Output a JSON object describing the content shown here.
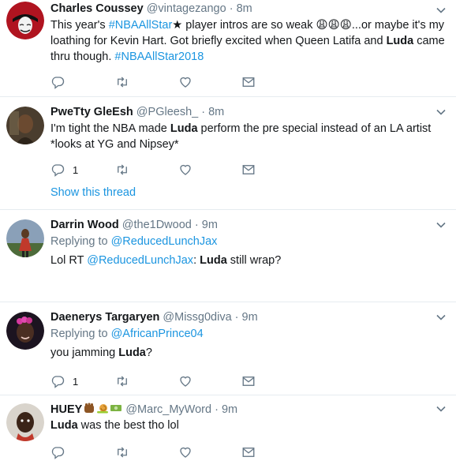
{
  "tweets": [
    {
      "name": "Charles Coussey",
      "handle": "@vintagezango",
      "separator": "·",
      "time": "8m",
      "segments": [
        {
          "t": "This year's "
        },
        {
          "t": "#NBAAllStar",
          "link": true
        },
        {
          "t": "★ player intros are so weak 😩😩😩...or maybe it's my loathing for Kevin Hart. Got briefly excited when Queen Latifa and "
        },
        {
          "t": "Luda",
          "bold": true
        },
        {
          "t": " came thru though. "
        },
        {
          "t": "#NBAAllStar2018",
          "link": true
        }
      ],
      "reply_count": "",
      "retweet_count": "",
      "like_count": ""
    },
    {
      "name": "PweTty GleEsh",
      "handle": "@PGleesh_",
      "separator": "·",
      "time": "8m",
      "segments": [
        {
          "t": "I'm tight the NBA made "
        },
        {
          "t": "Luda",
          "bold": true
        },
        {
          "t": " perform the pre special instead of an LA artist *looks at YG and Nipsey*"
        }
      ],
      "reply_count": "1",
      "retweet_count": "",
      "like_count": "",
      "show_thread": "Show this thread"
    },
    {
      "name": "Darrin Wood",
      "handle": "@the1Dwood",
      "separator": "·",
      "time": "9m",
      "replying_label": "Replying to",
      "replying_to": "@ReducedLunchJax",
      "segments": [
        {
          "t": "Lol RT "
        },
        {
          "t": "@ReducedLunchJax",
          "link": true
        },
        {
          "t": ": "
        },
        {
          "t": "Luda",
          "bold": true
        },
        {
          "t": " still wrap?"
        }
      ]
    },
    {
      "name": "Daenerys Targaryen",
      "handle": "@Missg0diva",
      "separator": "·",
      "time": "9m",
      "replying_label": "Replying to",
      "replying_to": "@AfricanPrince04",
      "segments": [
        {
          "t": "you jamming "
        },
        {
          "t": "Luda",
          "bold": true
        },
        {
          "t": "?"
        }
      ],
      "reply_count": "1",
      "retweet_count": "",
      "like_count": ""
    },
    {
      "name": "HUEY",
      "handle": "@Marc_MyWord",
      "separator": "·",
      "time": "9m",
      "segments": [
        {
          "t": "Luda",
          "bold": true
        },
        {
          "t": " was the best tho lol"
        }
      ],
      "reply_count": "",
      "retweet_count": "",
      "like_count": ""
    }
  ],
  "icons": {
    "reply": "reply-icon",
    "retweet": "retweet-icon",
    "like": "heart-icon",
    "dm": "envelope-icon",
    "caret": "chevron-down-icon"
  },
  "colors": {
    "link": "#1b95e0",
    "secondary": "#657786",
    "text": "#14171a",
    "divider": "#e6ecf0"
  }
}
